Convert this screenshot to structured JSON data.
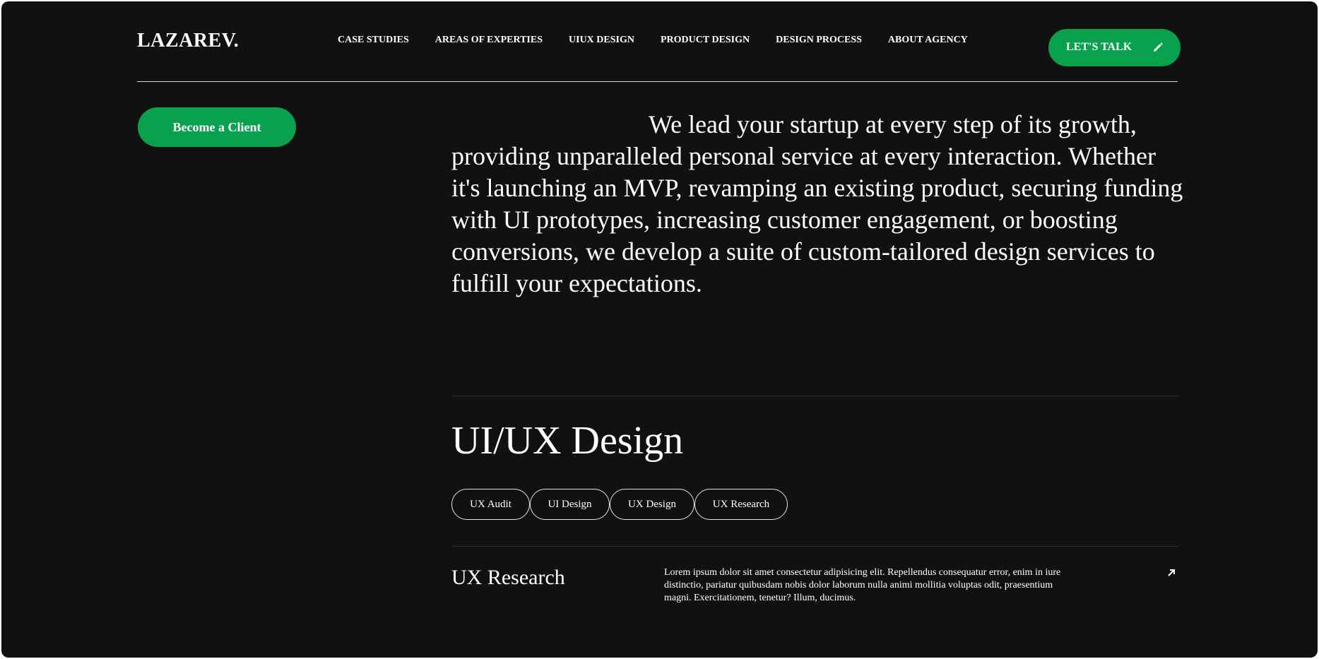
{
  "header": {
    "logo": "LAZAREV.",
    "nav": [
      "CASE STUDIES",
      "AREAS OF EXPERTIES",
      "UIUX DESIGN",
      "PRODUCT DESIGN",
      "DESIGN PROCESS",
      "ABOUT AGENCY"
    ],
    "cta_label": "LET'S TALK",
    "cta_icon": "pencil-icon"
  },
  "sidebar": {
    "client_button": "Become a Client"
  },
  "main": {
    "intro": "We lead your startup at every step of its growth, providing unparalleled personal service at every interaction. Whether it's launching an MVP, revamping an existing product, securing funding with UI prototypes, increasing customer engagement, or boosting conversions, we develop a suite of custom-tailored design services to fulfill your expectations.",
    "section_title": "UI/UX Design",
    "chips": [
      "UX Audit",
      "UI Design",
      "UX Design",
      "UX Research"
    ],
    "row": {
      "title": "UX Research",
      "description": "Lorem ipsum dolor sit amet consectetur adipisicing elit. Repellendus consequatur error, enim in iure distinctio, pariatur quibusdam nobis dolor laborum nulla animi mollitia voluptas odit, praesentium magni. Exercitationem, tenetur? Illum, ducimus.",
      "icon": "arrow-up-right-icon"
    }
  },
  "colors": {
    "background": "#111111",
    "accent": "#0aa14e",
    "text": "#ffffff"
  }
}
